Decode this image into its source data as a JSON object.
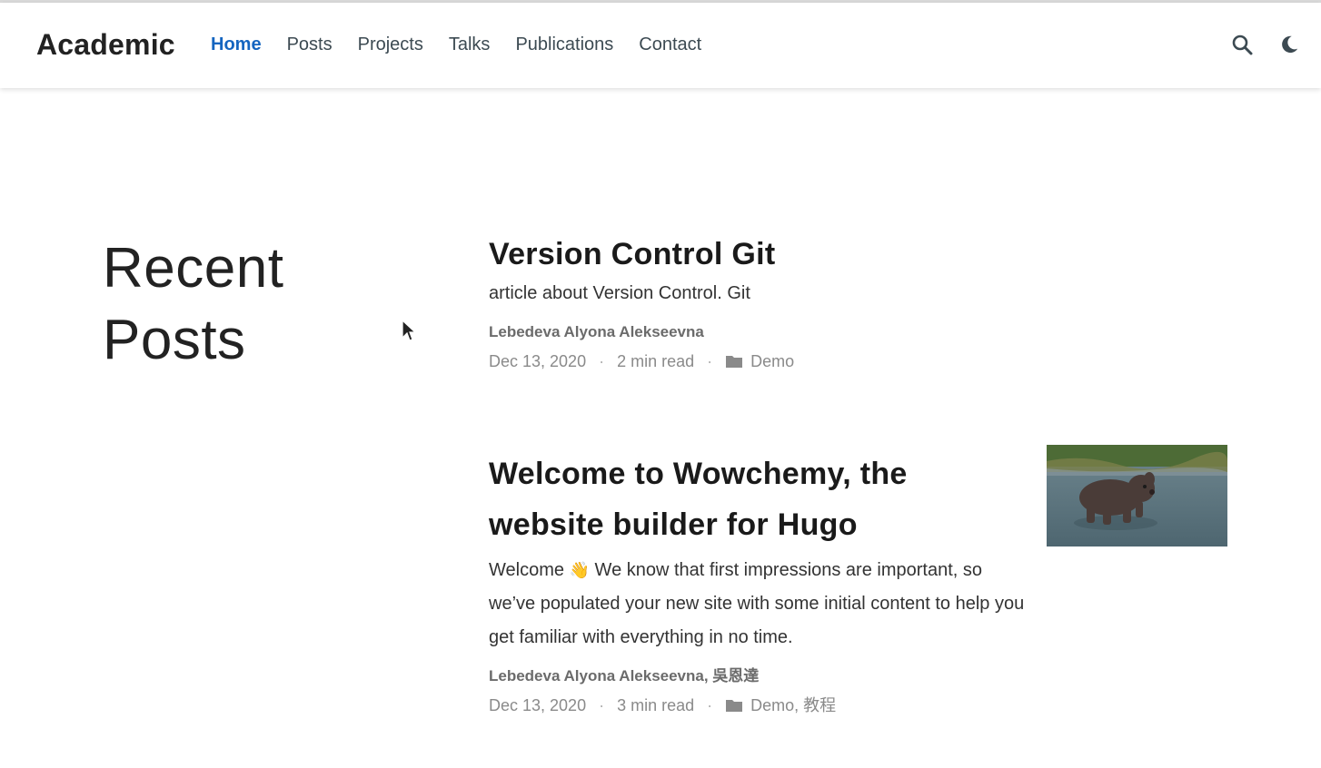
{
  "navbar": {
    "brand": "Academic",
    "items": [
      {
        "label": "Home",
        "active": true
      },
      {
        "label": "Posts",
        "active": false
      },
      {
        "label": "Projects",
        "active": false
      },
      {
        "label": "Talks",
        "active": false
      },
      {
        "label": "Publications",
        "active": false
      },
      {
        "label": "Contact",
        "active": false
      }
    ],
    "icons": [
      "search-icon",
      "moon-icon"
    ],
    "accent_color": "#1565c0"
  },
  "section": {
    "title_line1": "Recent",
    "title_line2": "Posts"
  },
  "posts": [
    {
      "title": "Version Control Git",
      "summary": "article about Version Control. Git",
      "authors": "Lebedeva Alyona Alekseevna",
      "date": "Dec 13, 2020",
      "read_time": "2 min read",
      "categories": "Demo"
    },
    {
      "title": "Welcome to Wowchemy, the website builder for Hugo",
      "summary_prefix": "Welcome",
      "summary_emoji": "👋",
      "summary": "We know that first impressions are important, so we’ve populated your new site with some initial content to help you get familiar with everything in no time.",
      "authors": "Lebedeva Alyona Alekseevna, 吳恩達",
      "date": "Dec 13, 2020",
      "read_time": "3 min read",
      "categories": "Demo, 教程",
      "image": "dog-running-thumbnail"
    }
  ]
}
